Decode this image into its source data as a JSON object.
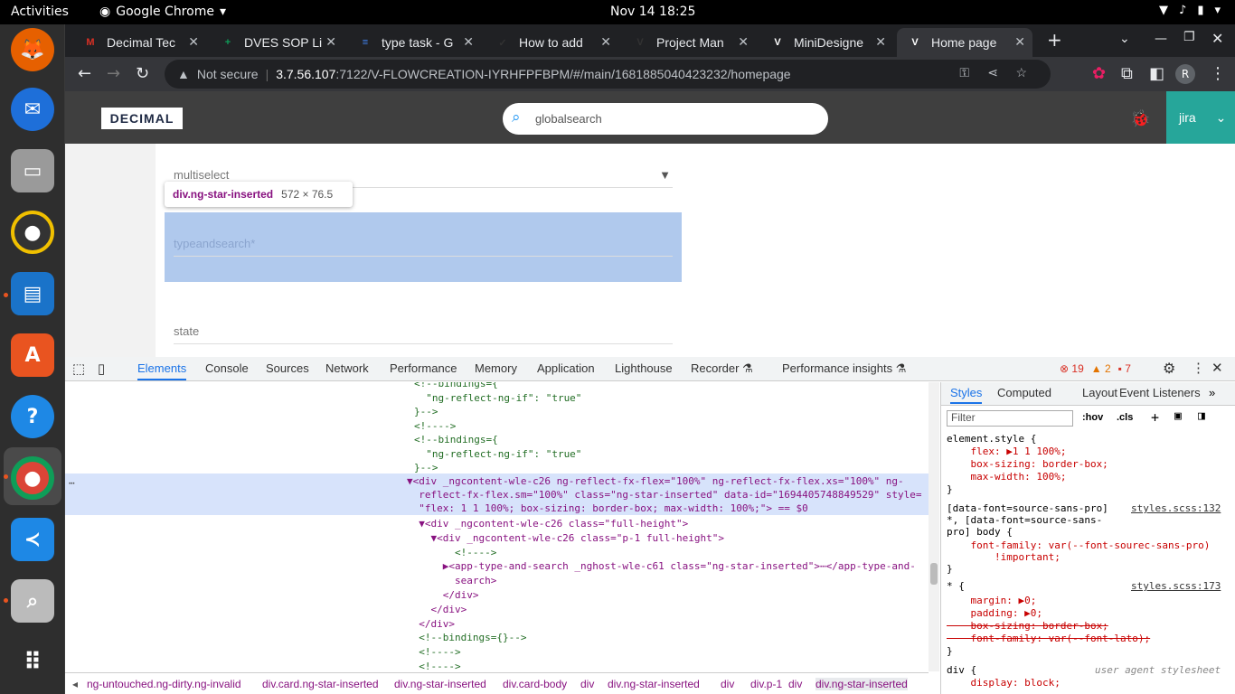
{
  "system": {
    "activities": "Activities",
    "app_name": "Google Chrome",
    "clock": "Nov 14  18:25"
  },
  "dock": [
    "firefox-icon",
    "thunderbird-icon",
    "files-icon",
    "rhythmbox-icon",
    "writer-icon",
    "software-icon",
    "help-icon",
    "chrome-icon",
    "vscode-icon",
    "search-icon",
    "apps-grid-icon"
  ],
  "tabs": [
    {
      "label": "Decimal Tec",
      "favicon": "M",
      "color": "#d93025"
    },
    {
      "label": "DVES SOP Li",
      "favicon": "+",
      "color": "#0f9d58"
    },
    {
      "label": "type task - G",
      "favicon": "≡",
      "color": "#4285f4"
    },
    {
      "label": "How to add",
      "favicon": "✓",
      "color": "#333"
    },
    {
      "label": "Project Man",
      "favicon": "V",
      "color": "#333"
    },
    {
      "label": "MiniDesigne",
      "favicon": "V",
      "color": "#fff"
    },
    {
      "label": "Home page",
      "favicon": "V",
      "color": "#fff"
    }
  ],
  "toolbar": {
    "not_secure": "Not secure",
    "host": "3.7.56.107",
    "path": ":7122/V-FLOWCREATION-IYRHFPFBPM/#/main/1681885040423232/homepage",
    "profile": "R"
  },
  "app": {
    "logo": "DECIMAL",
    "search_placeholder": "globalsearch",
    "user": "jira"
  },
  "form": {
    "multiselect": "multiselect",
    "typeandsearch": "typeandsearch*",
    "state": "state"
  },
  "tooltip": {
    "selector": "div.ng-star-inserted",
    "size": "572 × 76.5"
  },
  "devtools": {
    "tabs": [
      "Elements",
      "Console",
      "Sources",
      "Network",
      "Performance",
      "Memory",
      "Application",
      "Lighthouse",
      "Recorder ⚗",
      "Performance insights ⚗"
    ],
    "errors": "19",
    "warnings": "2",
    "issues": "7",
    "dom_lines": [
      {
        "t": "<!--bindings={",
        "c": "c-com",
        "i": 0
      },
      {
        "t": "  \"ng-reflect-ng-if\": \"true\"",
        "c": "c-com",
        "i": 0
      },
      {
        "t": "}-->",
        "c": "c-com",
        "i": 0
      },
      {
        "t": "<!---->",
        "c": "c-com",
        "i": 0
      },
      {
        "t": "<!--bindings={",
        "c": "c-com",
        "i": 0
      },
      {
        "t": "  \"ng-reflect-ng-if\": \"true\"",
        "c": "c-com",
        "i": 0
      },
      {
        "t": "}-->",
        "c": "c-com",
        "i": 0
      }
    ],
    "selected_lines": [
      "▼<div _ngcontent-wle-c26 ng-reflect-fx-flex=\"100%\" ng-reflect-fx-flex.xs=\"100%\" ng-",
      "  reflect-fx-flex.sm=\"100%\" class=\"ng-star-inserted\" data-id=\"1694405748849529\" style=",
      "  \"flex: 1 1 100%; box-sizing: border-box; max-width: 100%;\"> == $0"
    ],
    "dom_lines2": [
      {
        "t": "  ▼<div _ngcontent-wle-c26 class=\"full-height\">",
        "c": "c-tag"
      },
      {
        "t": "    ▼<div _ngcontent-wle-c26 class=\"p-1 full-height\">",
        "c": "c-tag"
      },
      {
        "t": "        <!---->",
        "c": "c-com"
      },
      {
        "t": "      ▶<app-type-and-search _nghost-wle-c61 class=\"ng-star-inserted\">⋯</app-type-and-",
        "c": "c-tag"
      },
      {
        "t": "        search>",
        "c": "c-tag"
      },
      {
        "t": "      </div>",
        "c": "c-tag"
      },
      {
        "t": "    </div>",
        "c": "c-tag"
      },
      {
        "t": "  </div>",
        "c": "c-tag"
      },
      {
        "t": "  <!--bindings={}-->",
        "c": "c-com"
      },
      {
        "t": "  <!---->",
        "c": "c-com"
      },
      {
        "t": "  <!---->",
        "c": "c-com"
      }
    ],
    "styles_tabs": [
      "Styles",
      "Computed",
      "Layout",
      "Event Listeners"
    ],
    "filter": "Filter",
    "hov": ":hov",
    "cls": ".cls",
    "rules": [
      "element.style {",
      "    flex: ▶1 1 100%;",
      "    box-sizing: border-box;",
      "    max-width: 100%;",
      "}",
      "[data-font=source-sans-pro]",
      "*, [data-font=source-sans-",
      "pro] body {",
      "    font-family: var(--font-sourec-sans-pro)",
      "        !important;",
      "}",
      "* {",
      "    margin: ▶0;",
      "    padding: ▶0;",
      "    box-sizing: border-box;",
      "    font-family: var(--font-lato);",
      "}",
      "div {",
      "    display: block;"
    ],
    "sources": [
      "styles.scss:132",
      "styles.scss:173",
      "user agent stylesheet"
    ],
    "crumbs": [
      "◂",
      "ng-untouched.ng-dirty.ng-invalid",
      "div.card.ng-star-inserted",
      "div.ng-star-inserted",
      "div.card-body",
      "div",
      "div.ng-star-inserted",
      "div",
      "div.p-1",
      "div",
      "div.ng-star-inserted"
    ]
  }
}
